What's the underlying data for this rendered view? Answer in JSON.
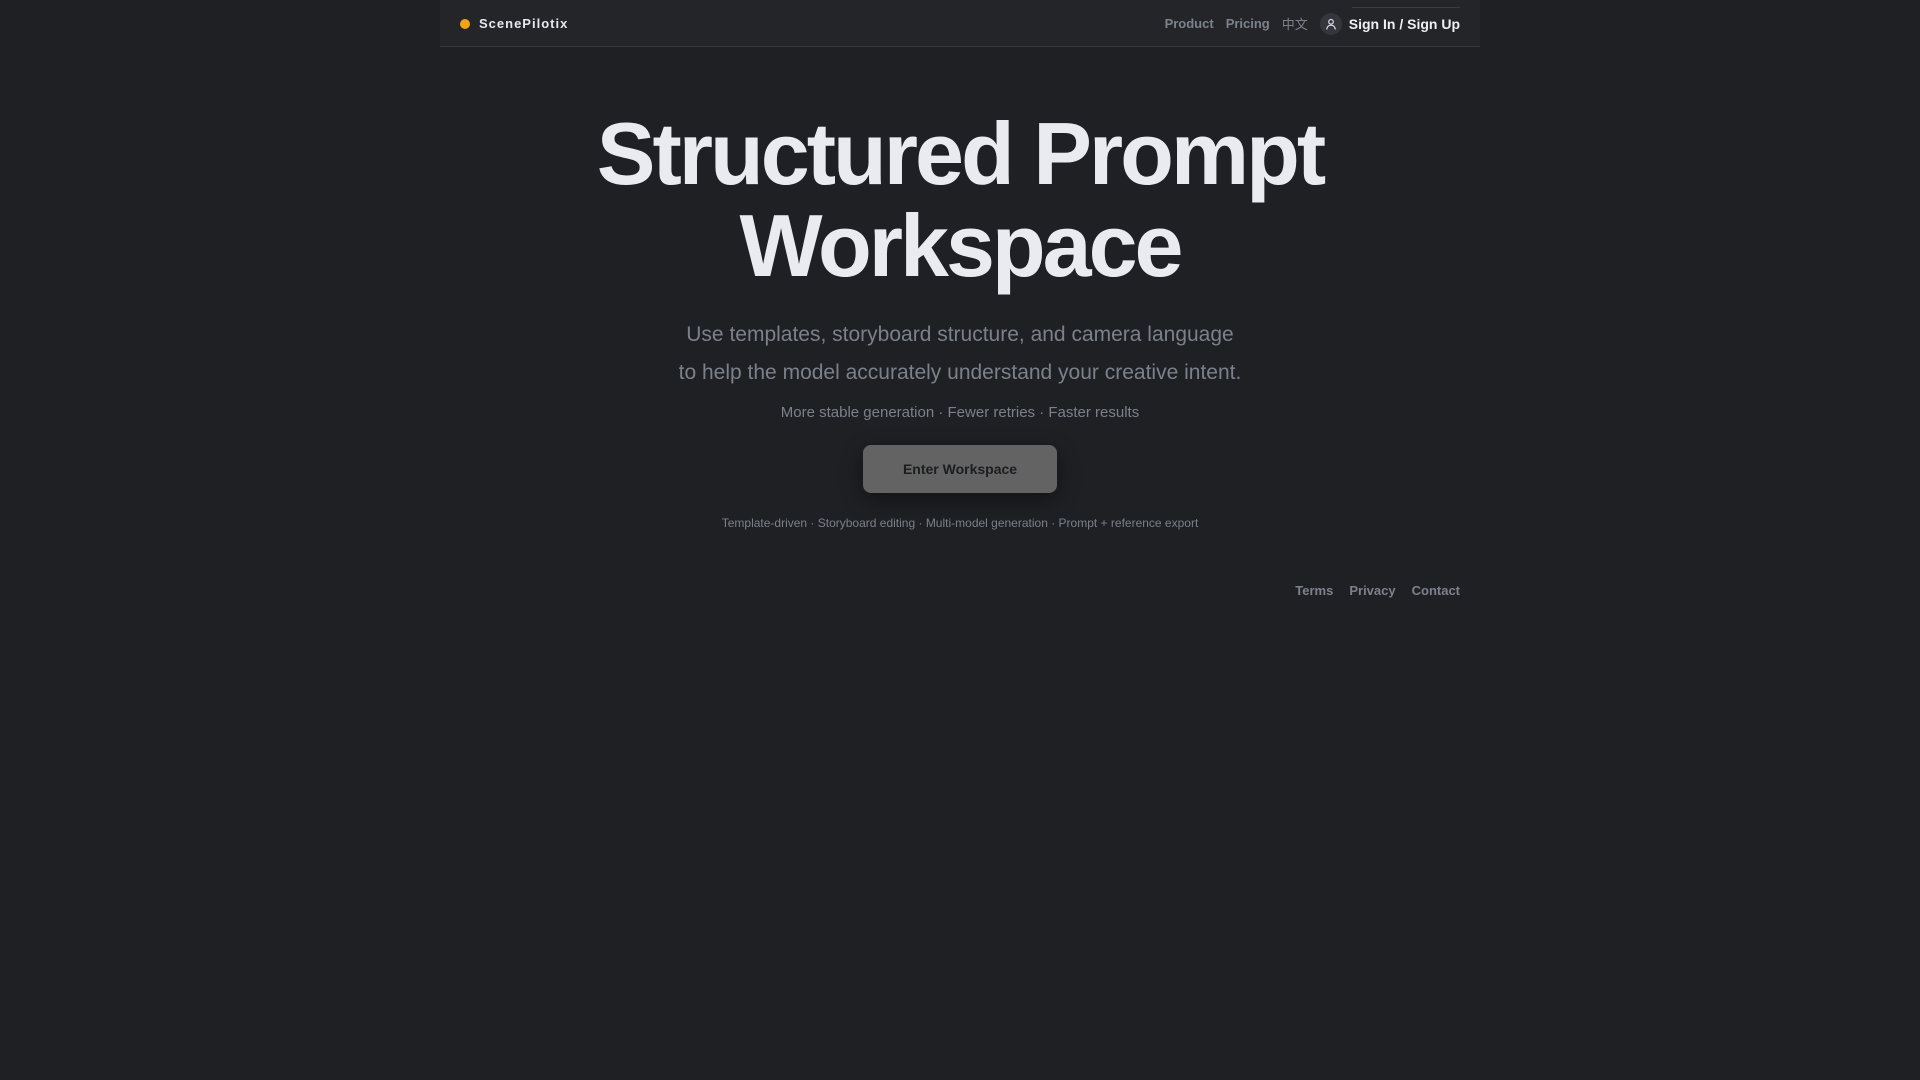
{
  "header": {
    "brand_name": "ScenePilotix",
    "brand_dot_color": "#f5a315",
    "nav": {
      "product": "Product",
      "pricing": "Pricing",
      "language": "中文"
    },
    "signin_label": "Sign In / Sign Up",
    "signin_icon": "user-icon"
  },
  "hero": {
    "title_line1": "Structured Prompt",
    "title_line2": "Workspace",
    "subtitle_line1": "Use templates, storyboard structure, and camera language",
    "subtitle_line2": "to help the model accurately understand your creative intent.",
    "tagline": "More stable generation · Fewer retries · Faster results",
    "cta_label": "Enter Workspace",
    "features": "Template-driven · Storyboard editing · Multi-model generation · Prompt + reference export"
  },
  "footer": {
    "terms": "Terms",
    "privacy": "Privacy",
    "contact": "Contact"
  },
  "colors": {
    "background": "#1f2024",
    "navbar": "#232529",
    "accent": "#f5a315",
    "button": "#636363",
    "muted_text": "#7b808b",
    "heading_text": "#e9ebf1"
  }
}
